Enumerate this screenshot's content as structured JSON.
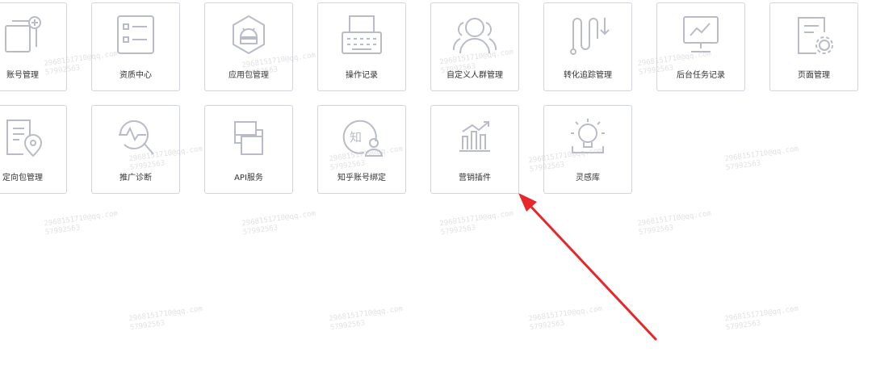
{
  "tiles_row1": [
    {
      "label": "账号管理",
      "icon": "account-cards-icon"
    },
    {
      "label": "资质中心",
      "icon": "qualification-list-icon"
    },
    {
      "label": "应用包管理",
      "icon": "android-package-icon"
    },
    {
      "label": "操作记录",
      "icon": "typewriter-icon"
    },
    {
      "label": "自定义人群管理",
      "icon": "user-group-icon"
    },
    {
      "label": "转化追踪管理",
      "icon": "conversion-track-icon"
    },
    {
      "label": "后台任务记录",
      "icon": "monitor-task-icon"
    },
    {
      "label": "页面管理",
      "icon": "page-settings-icon"
    }
  ],
  "tiles_row2": [
    {
      "label": "定向包管理",
      "icon": "document-location-icon"
    },
    {
      "label": "推广诊断",
      "icon": "diagnosis-magnifier-icon"
    },
    {
      "label": "API服务",
      "icon": "api-squares-icon"
    },
    {
      "label": "知乎账号绑定",
      "icon": "zhihu-bind-icon"
    },
    {
      "label": "营销插件",
      "icon": "marketing-chart-icon"
    },
    {
      "label": "灵感库",
      "icon": "lightbulb-icon"
    }
  ],
  "watermark": {
    "line1": "2968151710@qq.com",
    "line2": "57992563"
  },
  "colors": {
    "icon_stroke": "#b9bcc8",
    "tile_border": "#d3d5dc",
    "arrow": "#e8272a"
  }
}
